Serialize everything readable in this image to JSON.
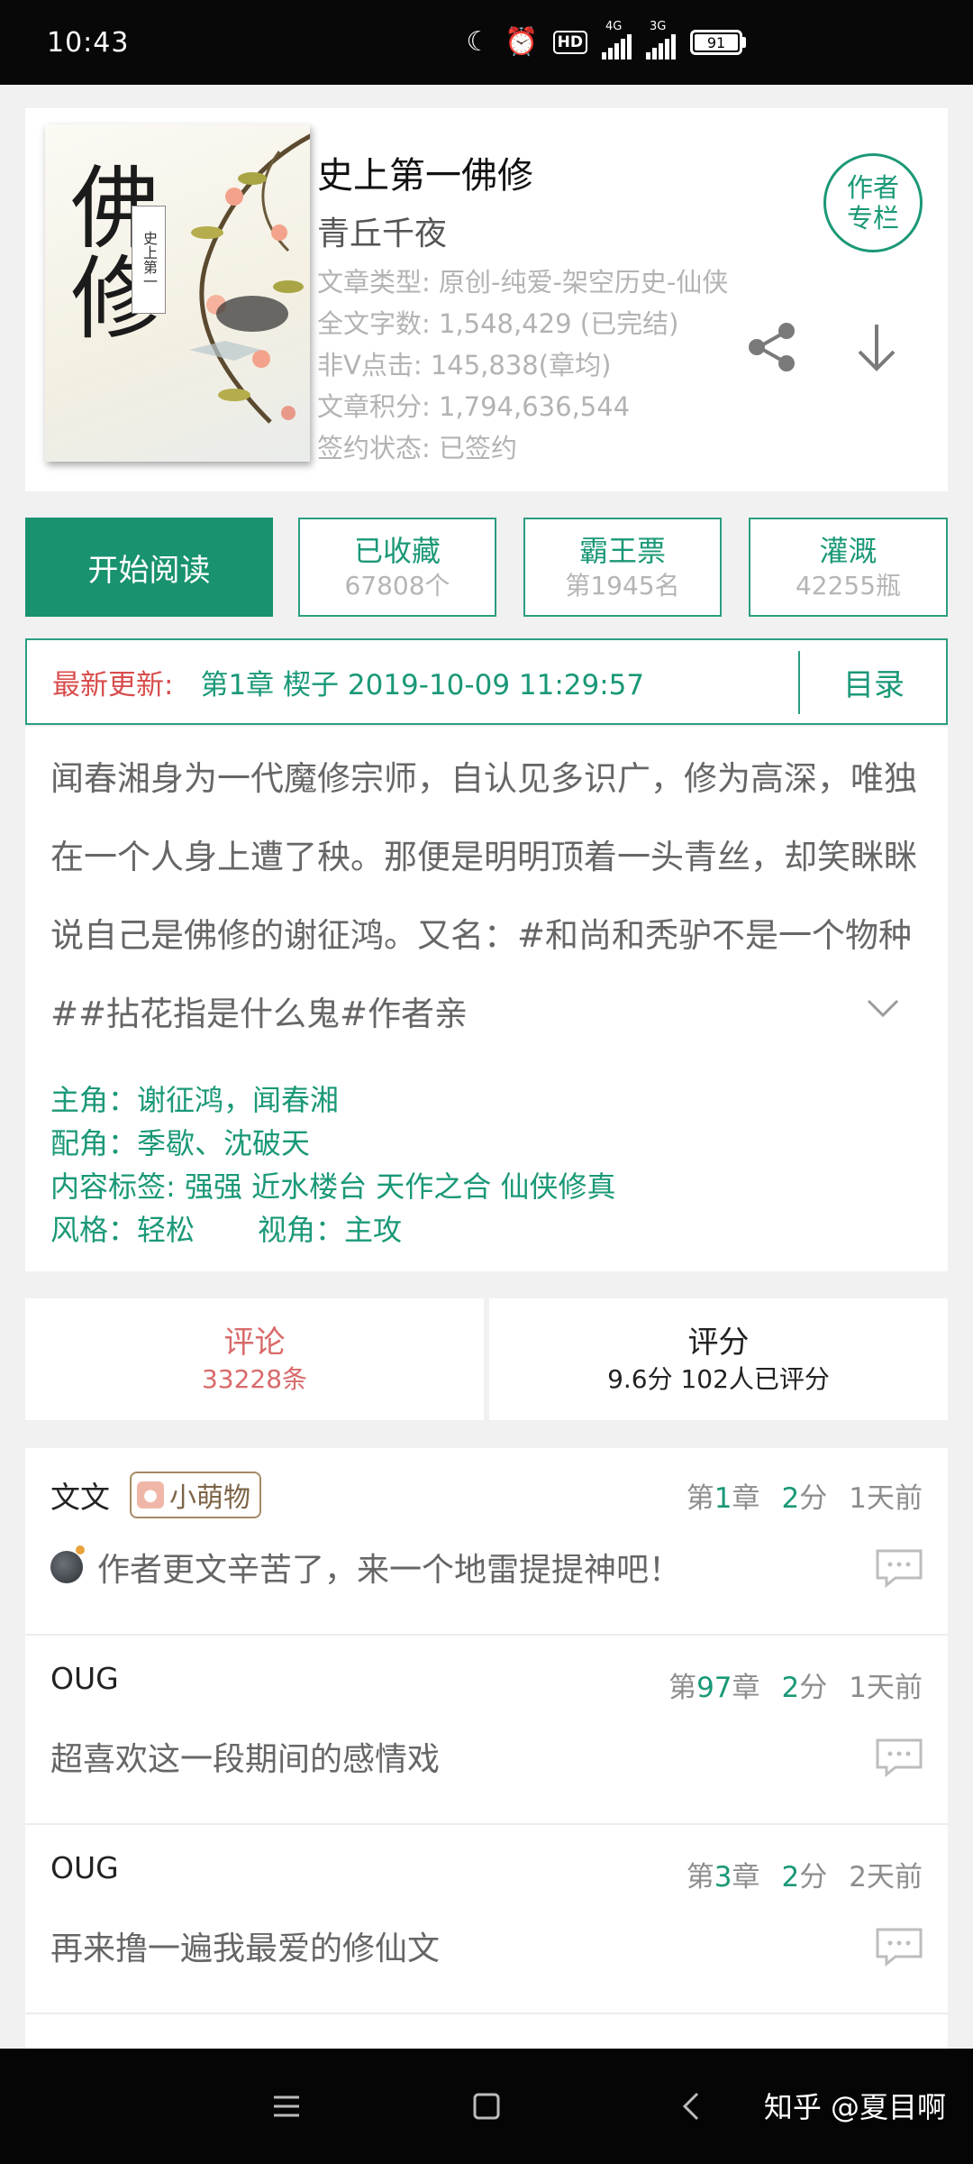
{
  "status_bar": {
    "time": "10:43",
    "signal_1": "4G",
    "signal_2": "3G",
    "battery": "91"
  },
  "book": {
    "title": "史上第一佛修",
    "author": "青丘千夜",
    "cover_title": "佛修",
    "cover_subtitle": "史上第一",
    "meta": [
      "文章类型: 原创-纯爱-架空历史-仙侠",
      "全文字数: 1,548,429 (已完结)",
      "非V点击: 145,838(章均)",
      "文章积分: 1,794,636,544",
      "签约状态: 已签约"
    ],
    "author_column_label": "作者专栏"
  },
  "actions": {
    "read_label": "开始阅读",
    "collect_label": "已收藏",
    "collect_count": "67808个",
    "ticket_label": "霸王票",
    "ticket_rank": "第1945名",
    "water_label": "灌溉",
    "water_count": "42255瓶"
  },
  "update": {
    "label": "最新更新:",
    "chapter": "第1章   楔子   2019-10-09 11:29:57",
    "toc_label": "目录"
  },
  "summary": {
    "text": "闻春湘身为一代魔修宗师，自认见多识广，修为高深，唯独在一个人身上遭了秧。那便是明明顶着一头青丝，却笑眯眯说自己是佛修的谢征鸿。又名：#和尚和秃驴不是一个物种##拈花指是什么鬼#作者亲"
  },
  "tags": {
    "protagonist": "主角：谢征鸿，闻春湘",
    "supporting": "配角：季歇、沈破天",
    "content_tags": "内容标签: 强强 近水楼台 天作之合 仙侠修真",
    "style": "风格：轻松",
    "perspective": "视角：主攻"
  },
  "tabs": {
    "comments_label": "评论",
    "comments_count": "33228条",
    "rating_label": "评分",
    "rating_value": "9.6分 102人已评分"
  },
  "comments": [
    {
      "user": "文文",
      "badge": "小萌物",
      "chapter_prefix": "第",
      "chapter_num": "1",
      "chapter_suffix": "章",
      "score_num": "2",
      "score_suffix": "分",
      "time": "1天前",
      "text": "作者更文辛苦了，来一个地雷提提神吧！"
    },
    {
      "user": "OUG",
      "chapter_prefix": "第",
      "chapter_num": "97",
      "chapter_suffix": "章",
      "score_num": "2",
      "score_suffix": "分",
      "time": "1天前",
      "text": "超喜欢这一段期间的感情戏"
    },
    {
      "user": "OUG",
      "chapter_prefix": "第",
      "chapter_num": "3",
      "chapter_suffix": "章",
      "score_num": "2",
      "score_suffix": "分",
      "time": "2天前",
      "text": "再来撸一遍我最爱的修仙文"
    }
  ],
  "watermark": "知乎 @夏目啊",
  "colors": {
    "accent": "#18926f",
    "latest_label": "#d94d4d",
    "comments_tab": "#d96a6a"
  }
}
